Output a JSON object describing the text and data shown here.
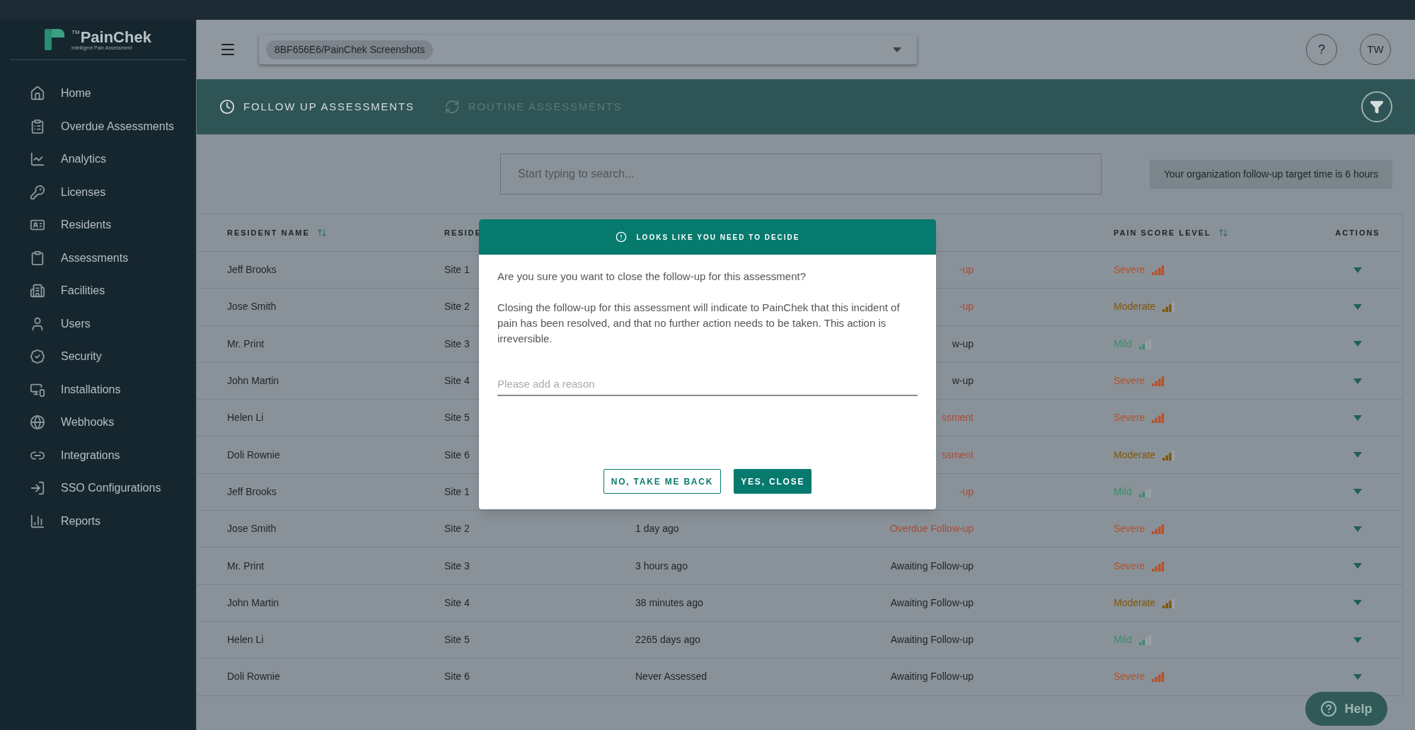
{
  "sidebar": {
    "logo": {
      "name": "PainChek",
      "trademark": "TM",
      "tagline": "Intelligent Pain Assessment"
    },
    "items": [
      {
        "label": "Home"
      },
      {
        "label": "Overdue Assessments"
      },
      {
        "label": "Analytics"
      },
      {
        "label": "Licenses"
      },
      {
        "label": "Residents"
      },
      {
        "label": "Assessments"
      },
      {
        "label": "Facilities"
      },
      {
        "label": "Users"
      },
      {
        "label": "Security"
      },
      {
        "label": "Installations"
      },
      {
        "label": "Webhooks"
      },
      {
        "label": "Integrations"
      },
      {
        "label": "SSO Configurations"
      },
      {
        "label": "Reports"
      }
    ]
  },
  "header": {
    "org_selector": "8BF656E6/PainChek Screenshots",
    "help": "?",
    "avatar": "TW"
  },
  "tabs": [
    {
      "label": "FOLLOW UP ASSESSMENTS",
      "selected": true
    },
    {
      "label": "ROUTINE ASSESSMENTS",
      "selected": false
    }
  ],
  "search": {
    "placeholder": "Start typing to search..."
  },
  "target_note": "Your organization follow-up target time is 6 hours",
  "table": {
    "columns": [
      "RESIDENT NAME",
      "RESIDE",
      "PAIN SCORE LEVEL",
      "ACTIONS"
    ],
    "rows": [
      {
        "name": "Jeff Brooks",
        "site": "Site 1",
        "status": "-up",
        "overdue": true,
        "pain": "Severe",
        "kind": "severe"
      },
      {
        "name": "Jose Smith",
        "site": "Site 2",
        "status": "-up",
        "overdue": true,
        "pain": "Moderate",
        "kind": "moderate"
      },
      {
        "name": "Mr. Print",
        "site": "Site 3",
        "status": "w-up",
        "overdue": false,
        "pain": "Mild",
        "kind": "mild"
      },
      {
        "name": "John Martin",
        "site": "Site 4",
        "status": "w-up",
        "overdue": false,
        "pain": "Severe",
        "kind": "severe"
      },
      {
        "name": "Helen Li",
        "site": "Site 5",
        "status": "ssment",
        "overdue": true,
        "pain": "Severe",
        "kind": "severe"
      },
      {
        "name": "Doli Rownie",
        "site": "Site 6",
        "status": "ssment",
        "overdue": true,
        "pain": "Moderate",
        "kind": "moderate"
      },
      {
        "name": "Jeff Brooks",
        "site": "Site 1",
        "status": "-up",
        "overdue": true,
        "pain": "Mild",
        "kind": "mild"
      },
      {
        "name": "Jose Smith",
        "site": "Site 2",
        "date": "1 day ago",
        "status": "Overdue Follow-up",
        "overdue": true,
        "pain": "Severe",
        "kind": "severe"
      },
      {
        "name": "Mr. Print",
        "site": "Site 3",
        "date": "3 hours ago",
        "status": "Awaiting Follow-up",
        "overdue": false,
        "pain": "Severe",
        "kind": "severe"
      },
      {
        "name": "John Martin",
        "site": "Site 4",
        "date": "38 minutes ago",
        "status": "Awaiting Follow-up",
        "overdue": false,
        "pain": "Moderate",
        "kind": "moderate"
      },
      {
        "name": "Helen Li",
        "site": "Site 5",
        "date": "2265 days ago",
        "status": "Awaiting Follow-up",
        "overdue": false,
        "pain": "Mild",
        "kind": "mild"
      },
      {
        "name": "Doli Rownie",
        "site": "Site 6",
        "date": "Never Assessed",
        "status": "Awaiting Follow-up",
        "overdue": false,
        "pain": "Severe",
        "kind": "severe"
      }
    ]
  },
  "dialog": {
    "title": "LOOKS LIKE YOU NEED TO DECIDE",
    "question": "Are you sure you want to close the follow-up for this assessment?",
    "message": "Closing the follow-up for this assessment will indicate to PainChek that this incident of pain has been resolved, and that no further action needs to be taken. This action is irreversible.",
    "reason": {
      "placeholder": "Please add a reason"
    },
    "buttons": [
      {
        "label": "NO, TAKE ME BACK",
        "kind": "secondary"
      },
      {
        "label": "YES, CLOSE",
        "kind": "primary"
      }
    ]
  },
  "help_button": "Help"
}
